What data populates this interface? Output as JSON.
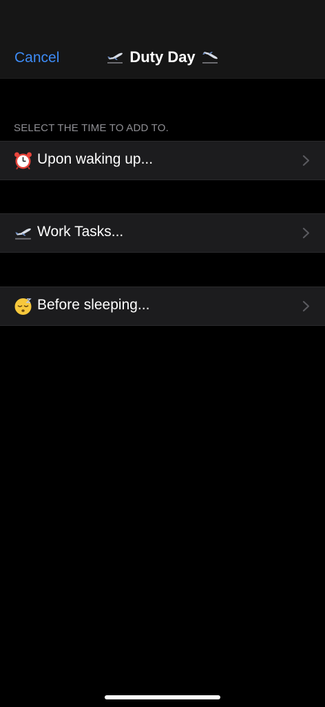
{
  "nav": {
    "cancel_label": "Cancel",
    "title": "Duty Day",
    "title_icon_left": "airplane-departure-icon",
    "title_icon_right": "airplane-arrival-icon"
  },
  "section": {
    "header": "SELECT THE TIME TO ADD TO."
  },
  "rows": [
    {
      "icon": "alarm-clock-icon",
      "label": "Upon waking up..."
    },
    {
      "icon": "airplane-departure-icon",
      "label": "Work Tasks..."
    },
    {
      "icon": "sleeping-face-icon",
      "label": "Before sleeping..."
    }
  ],
  "colors": {
    "accent": "#3d8bf5",
    "background": "#000000",
    "row_background": "#1c1c1e",
    "nav_background": "#161616",
    "secondary_text": "#8e8e93"
  }
}
